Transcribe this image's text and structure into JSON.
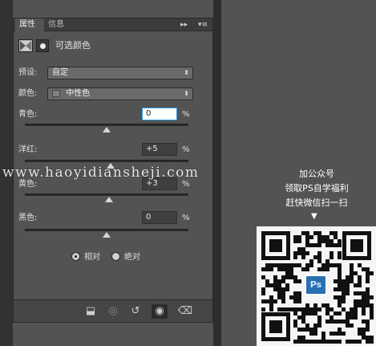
{
  "tabs": {
    "properties": "属性",
    "info": "信息",
    "collapse_glyph": "▸▸",
    "menu_glyph": "▾≡"
  },
  "header": {
    "title": "可选颜色",
    "icon1": "adjustment-layer-icon",
    "icon2": "layer-mask-icon"
  },
  "preset": {
    "label": "预设:",
    "value": "自定"
  },
  "colors": {
    "label": "颜色:",
    "value": "中性色"
  },
  "sliders": [
    {
      "label": "青色:",
      "value": "0",
      "unit": "%",
      "level": 0.5
    },
    {
      "label": "洋红:",
      "value": "+5",
      "unit": "%",
      "level": 0.525
    },
    {
      "label": "黄色:",
      "value": "+3",
      "unit": "%",
      "level": 0.515
    },
    {
      "label": "黑色:",
      "value": "0",
      "unit": "%",
      "level": 0.5
    }
  ],
  "method": {
    "relative": "相对",
    "absolute": "绝对",
    "selected": "relative"
  },
  "bottom_icons": [
    "clip-to-layer-icon",
    "view-previous-icon",
    "reset-icon",
    "visibility-icon",
    "delete-icon"
  ],
  "watermark": "www.haoyidianshejі.com",
  "promo": {
    "line1": "加公众号",
    "line2": "领取PS自学福利",
    "line3": "赶快微信扫一扫",
    "arrow": "▼",
    "logo": "Ps"
  },
  "colors_palette": {
    "panel": "#535353",
    "focus": "#2c9dea",
    "logo": "#2a6fb0"
  }
}
